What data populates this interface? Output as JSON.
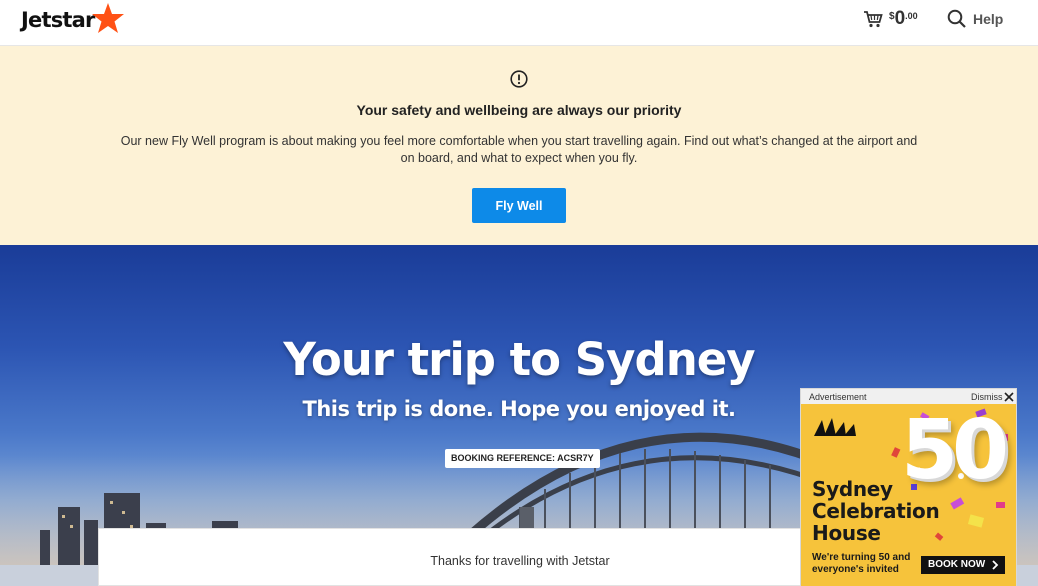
{
  "header": {
    "logo_text": "Jetstar",
    "cart": {
      "currency": "$",
      "amount": "0",
      "decimals": ".00"
    },
    "help_label": "Help"
  },
  "notice": {
    "title": "Your safety and wellbeing are always our priority",
    "body": "Our new Fly Well program is about making you feel more comfortable when you start travelling again. Find out what’s changed at the airport and on board, and what to expect when you fly.",
    "button_label": "Fly Well"
  },
  "hero": {
    "title": "Your trip to Sydney",
    "subtitle": "This trip is done. Hope you enjoyed it.",
    "booking_ref": "BOOKING REFERENCE: ACSR7Y"
  },
  "card": {
    "text": "Thanks for travelling with Jetstar"
  },
  "ad": {
    "label": "Advertisement",
    "dismiss": "Dismiss",
    "big_number": "50",
    "title_line1": "Sydney",
    "title_line2": "Celebration",
    "title_line3": "House",
    "note_line1": "We're turning 50 and",
    "note_line2": "everyone's invited",
    "cta": "BOOK NOW"
  },
  "colors": {
    "brand_orange": "#ff5115",
    "notice_bg": "#fdf2d6",
    "button_blue": "#0d8ae8",
    "ad_yellow": "#f6c33b"
  }
}
